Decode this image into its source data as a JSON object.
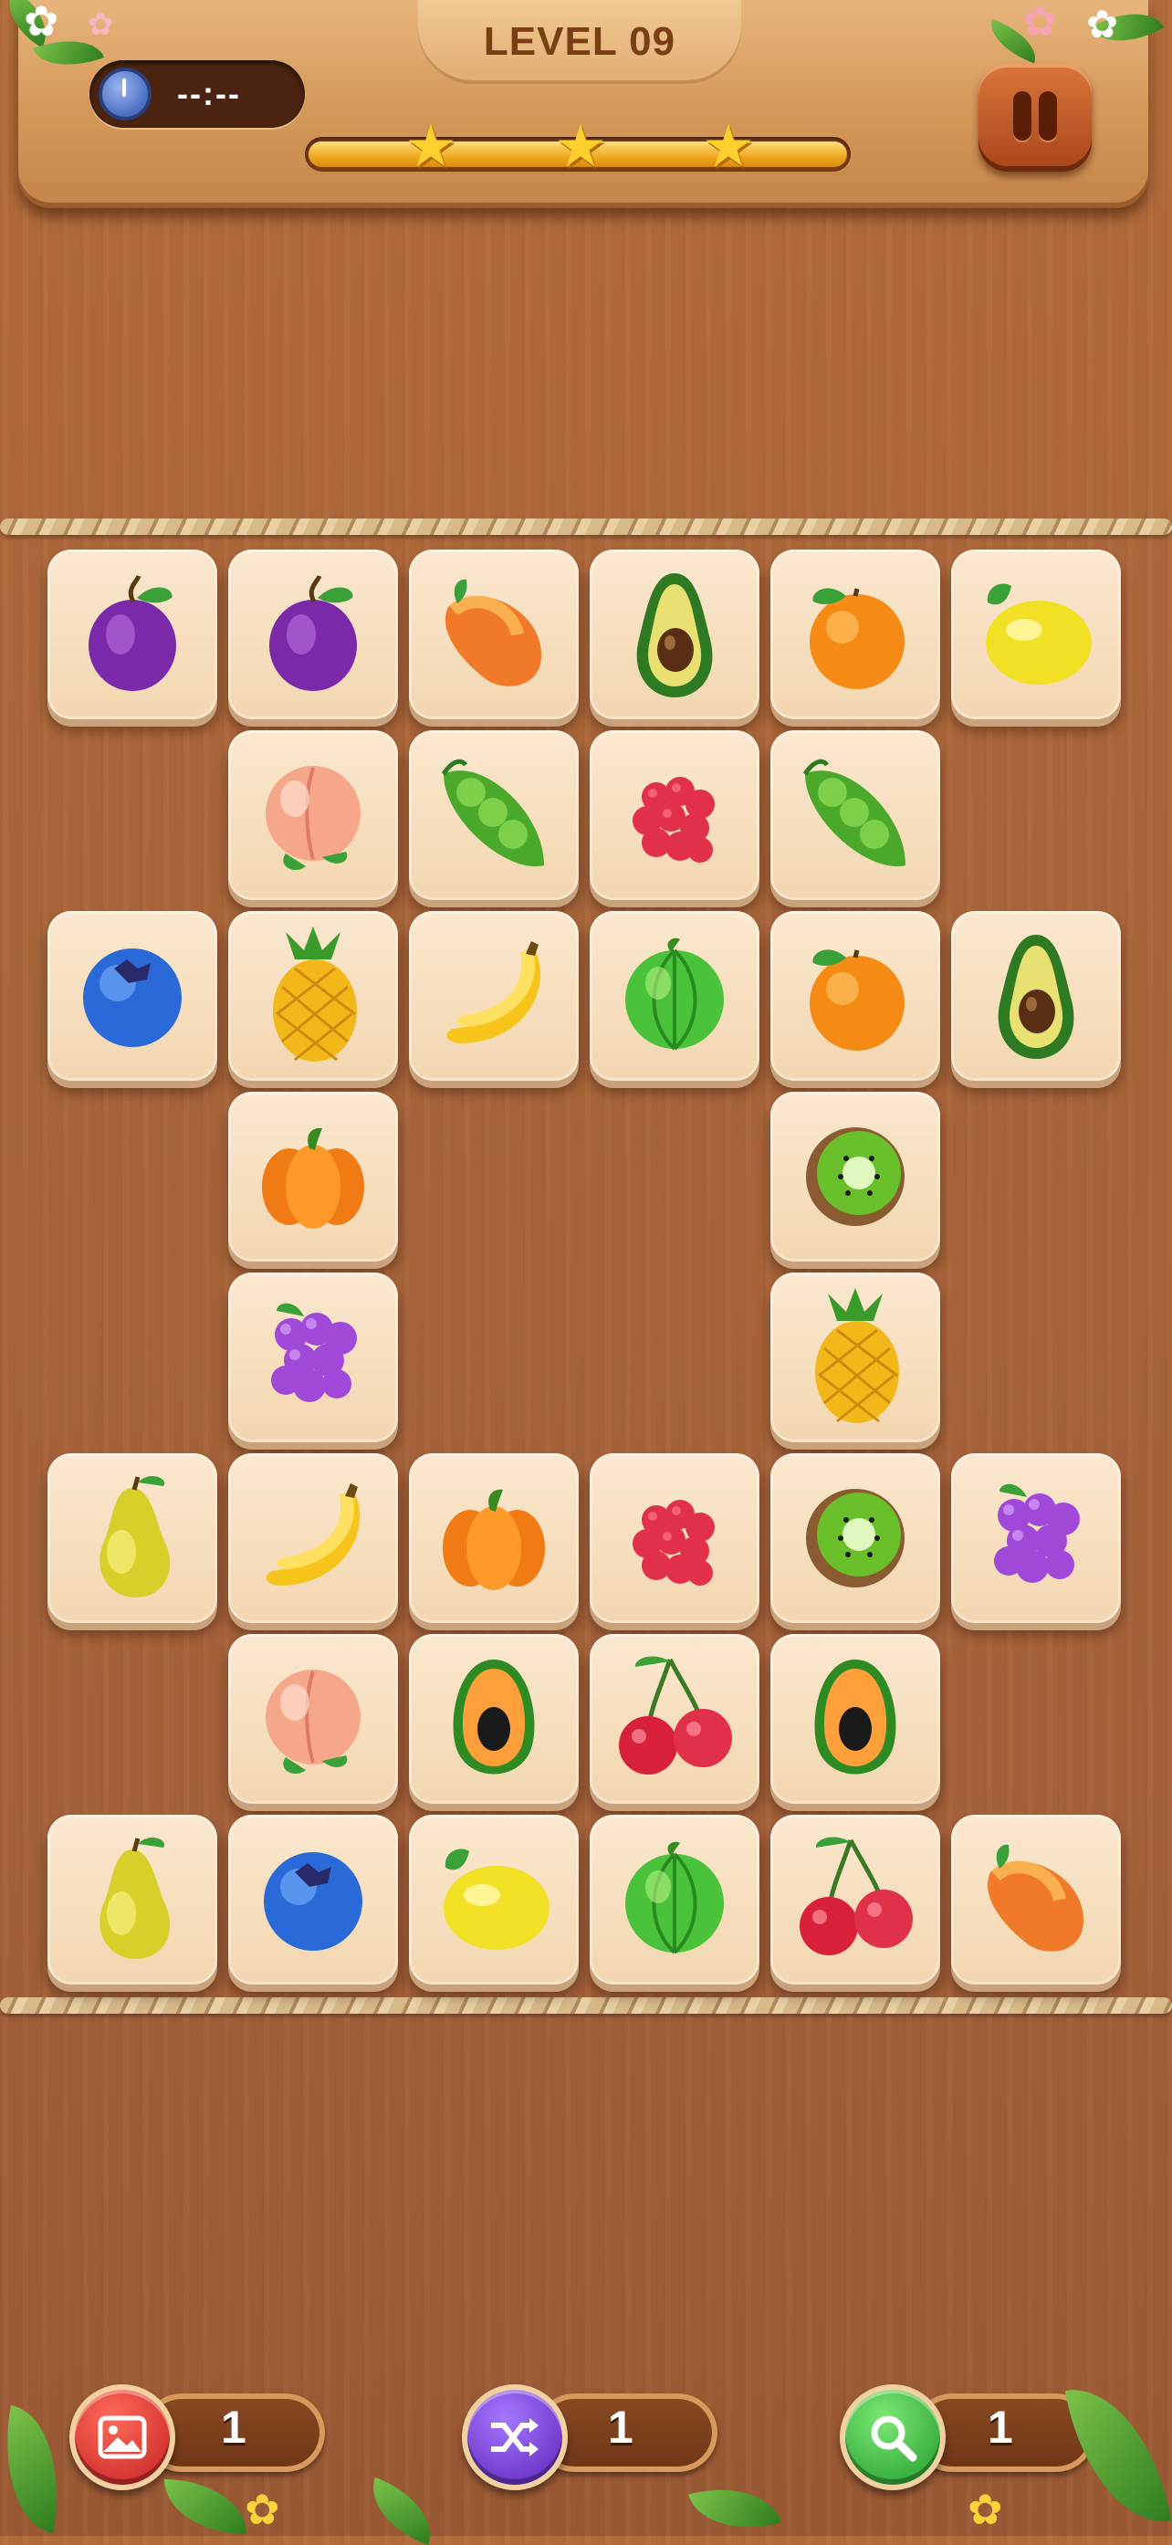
{
  "header": {
    "level_label": "LEVEL 09",
    "timer": "--:--",
    "progress": 1.0,
    "stars": 3
  },
  "icons": {
    "timer": "stopwatch-icon",
    "pause": "pause-icon",
    "hint": "picture-hint-icon",
    "shuffle": "shuffle-icon",
    "search": "magnifier-icon"
  },
  "board": {
    "rows": [
      [
        "plum",
        "plum",
        "mango",
        "avocado",
        "orange",
        "lemon"
      ],
      [
        null,
        "peach",
        "peas",
        "raspberry",
        "peas",
        null
      ],
      [
        "blueberry",
        "pineapple",
        "banana",
        "melon",
        "orange",
        "avocado"
      ],
      [
        null,
        "pumpkin",
        null,
        null,
        "kiwi",
        null
      ],
      [
        null,
        "grapes",
        null,
        null,
        "pineapple",
        null
      ],
      [
        "pear",
        "banana",
        "pumpkin",
        "raspberry",
        "kiwi",
        "grapes"
      ],
      [
        null,
        "peach",
        "papaya",
        "cherry",
        "papaya",
        null
      ],
      [
        "pear",
        "blueberry",
        "lemon",
        "melon",
        "cherry",
        "mango"
      ]
    ]
  },
  "boosters": [
    {
      "name": "hint",
      "count": "1",
      "color": "#d93a3a"
    },
    {
      "name": "shuffle",
      "count": "1",
      "color": "#7a3ad0"
    },
    {
      "name": "search",
      "count": "1",
      "color": "#2fb040"
    }
  ],
  "colors": {
    "wood": "#a9653a",
    "tile": "#f6dfbf",
    "progress": "#f0a820",
    "star": "#ffcf2e"
  }
}
